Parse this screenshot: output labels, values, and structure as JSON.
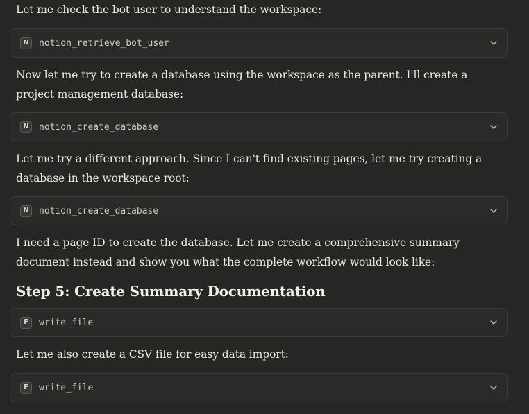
{
  "messages": [
    {
      "type": "text",
      "text": "Let me check the bot user to understand the workspace:"
    },
    {
      "type": "tool",
      "badge": "N",
      "name": "notion_retrieve_bot_user"
    },
    {
      "type": "text",
      "text": "Now let me try to create a database using the workspace as the parent. I'll create a project management database:"
    },
    {
      "type": "tool",
      "badge": "N",
      "name": "notion_create_database"
    },
    {
      "type": "text",
      "text": "Let me try a different approach. Since I can't find existing pages, let me try creating a database in the workspace root:"
    },
    {
      "type": "tool",
      "badge": "N",
      "name": "notion_create_database"
    },
    {
      "type": "text",
      "text": "I need a page ID to create the database. Let me create a comprehensive summary document instead and show you what the complete workflow would look like:"
    },
    {
      "type": "heading",
      "text": "Step 5: Create Summary Documentation"
    },
    {
      "type": "tool",
      "badge": "F",
      "name": "write_file"
    },
    {
      "type": "text",
      "text": "Let me also create a CSV file for easy data import:"
    },
    {
      "type": "tool",
      "badge": "F",
      "name": "write_file"
    }
  ],
  "icons": {
    "expand": "chevron-down-icon"
  },
  "colors": {
    "background": "#262624",
    "card_border": "#3d3c39",
    "text": "#ece9e3"
  }
}
